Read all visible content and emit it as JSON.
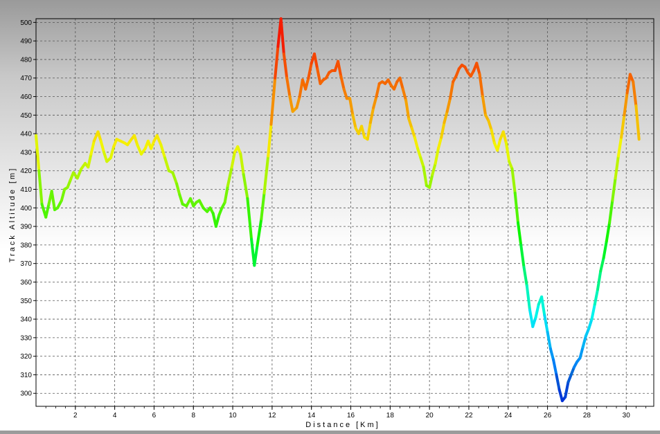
{
  "chart_data": {
    "type": "line",
    "title": "",
    "xlabel": "Distance [Km]",
    "ylabel": "Track Altitude [m]",
    "xlim": [
      0,
      31.4
    ],
    "ylim": [
      293,
      502
    ],
    "x_ticks": [
      "2",
      "4",
      "6",
      "8",
      "10",
      "12",
      "14",
      "16",
      "18",
      "20",
      "22",
      "24",
      "26",
      "28",
      "30"
    ],
    "y_ticks": [
      "300",
      "310",
      "320",
      "330",
      "340",
      "350",
      "360",
      "370",
      "380",
      "390",
      "400",
      "410",
      "420",
      "430",
      "440",
      "450",
      "460",
      "470",
      "480",
      "490",
      "500"
    ],
    "grid": true,
    "line_colormap": "altitude: blue (low) → cyan → green → yellow → orange → red (high)",
    "series": [
      {
        "points": [
          [
            0.0,
            439
          ],
          [
            0.15,
            420
          ],
          [
            0.3,
            402
          ],
          [
            0.5,
            395
          ],
          [
            0.65,
            402
          ],
          [
            0.8,
            409
          ],
          [
            0.95,
            399
          ],
          [
            1.1,
            400
          ],
          [
            1.3,
            404
          ],
          [
            1.45,
            410
          ],
          [
            1.6,
            411
          ],
          [
            1.75,
            415
          ],
          [
            1.9,
            419
          ],
          [
            2.1,
            416
          ],
          [
            2.3,
            421
          ],
          [
            2.5,
            424
          ],
          [
            2.65,
            422
          ],
          [
            2.8,
            429
          ],
          [
            2.95,
            436
          ],
          [
            3.15,
            441
          ],
          [
            3.3,
            436
          ],
          [
            3.45,
            430
          ],
          [
            3.6,
            425
          ],
          [
            3.8,
            427
          ],
          [
            3.95,
            433
          ],
          [
            4.1,
            437
          ],
          [
            4.3,
            436
          ],
          [
            4.5,
            435
          ],
          [
            4.65,
            434
          ],
          [
            4.85,
            437
          ],
          [
            5.0,
            439
          ],
          [
            5.15,
            434
          ],
          [
            5.35,
            429
          ],
          [
            5.55,
            432
          ],
          [
            5.7,
            436
          ],
          [
            5.85,
            432
          ],
          [
            6.0,
            436
          ],
          [
            6.15,
            439
          ],
          [
            6.35,
            434
          ],
          [
            6.55,
            427
          ],
          [
            6.75,
            420
          ],
          [
            6.95,
            419
          ],
          [
            7.15,
            413
          ],
          [
            7.3,
            407
          ],
          [
            7.45,
            402
          ],
          [
            7.65,
            401
          ],
          [
            7.85,
            405
          ],
          [
            8.0,
            401
          ],
          [
            8.15,
            403
          ],
          [
            8.3,
            404
          ],
          [
            8.5,
            400
          ],
          [
            8.7,
            398
          ],
          [
            8.85,
            400
          ],
          [
            9.0,
            397
          ],
          [
            9.15,
            390
          ],
          [
            9.3,
            396
          ],
          [
            9.45,
            400
          ],
          [
            9.6,
            403
          ],
          [
            9.75,
            412
          ],
          [
            9.95,
            422
          ],
          [
            10.1,
            430
          ],
          [
            10.25,
            433
          ],
          [
            10.4,
            429
          ],
          [
            10.55,
            418
          ],
          [
            10.75,
            405
          ],
          [
            10.95,
            383
          ],
          [
            11.1,
            369
          ],
          [
            11.25,
            380
          ],
          [
            11.45,
            394
          ],
          [
            11.6,
            408
          ],
          [
            11.8,
            428
          ],
          [
            11.95,
            445
          ],
          [
            12.15,
            470
          ],
          [
            12.3,
            487
          ],
          [
            12.45,
            502
          ],
          [
            12.6,
            483
          ],
          [
            12.75,
            470
          ],
          [
            12.9,
            460
          ],
          [
            13.05,
            452
          ],
          [
            13.25,
            454
          ],
          [
            13.4,
            460
          ],
          [
            13.55,
            469
          ],
          [
            13.7,
            464
          ],
          [
            13.85,
            470
          ],
          [
            14.0,
            478
          ],
          [
            14.15,
            483
          ],
          [
            14.3,
            475
          ],
          [
            14.45,
            467
          ],
          [
            14.6,
            469
          ],
          [
            14.75,
            470
          ],
          [
            14.9,
            473
          ],
          [
            15.05,
            474
          ],
          [
            15.2,
            474
          ],
          [
            15.35,
            479
          ],
          [
            15.5,
            471
          ],
          [
            15.65,
            464
          ],
          [
            15.8,
            459
          ],
          [
            15.95,
            459
          ],
          [
            16.1,
            450
          ],
          [
            16.25,
            443
          ],
          [
            16.4,
            440
          ],
          [
            16.55,
            444
          ],
          [
            16.7,
            438
          ],
          [
            16.85,
            437
          ],
          [
            17.0,
            446
          ],
          [
            17.15,
            454
          ],
          [
            17.3,
            460
          ],
          [
            17.45,
            467
          ],
          [
            17.6,
            468
          ],
          [
            17.75,
            467
          ],
          [
            17.9,
            469
          ],
          [
            18.05,
            466
          ],
          [
            18.2,
            464
          ],
          [
            18.35,
            468
          ],
          [
            18.5,
            470
          ],
          [
            18.65,
            464
          ],
          [
            18.8,
            458
          ],
          [
            18.95,
            448
          ],
          [
            19.1,
            443
          ],
          [
            19.25,
            438
          ],
          [
            19.4,
            432
          ],
          [
            19.55,
            427
          ],
          [
            19.7,
            422
          ],
          [
            19.85,
            412
          ],
          [
            20.0,
            411
          ],
          [
            20.15,
            418
          ],
          [
            20.3,
            424
          ],
          [
            20.45,
            432
          ],
          [
            20.6,
            438
          ],
          [
            20.75,
            446
          ],
          [
            20.9,
            452
          ],
          [
            21.05,
            459
          ],
          [
            21.2,
            468
          ],
          [
            21.35,
            471
          ],
          [
            21.5,
            475
          ],
          [
            21.65,
            477
          ],
          [
            21.8,
            476
          ],
          [
            21.95,
            473
          ],
          [
            22.1,
            471
          ],
          [
            22.25,
            474
          ],
          [
            22.4,
            478
          ],
          [
            22.55,
            472
          ],
          [
            22.7,
            460
          ],
          [
            22.85,
            450
          ],
          [
            23.0,
            447
          ],
          [
            23.15,
            442
          ],
          [
            23.3,
            435
          ],
          [
            23.45,
            431
          ],
          [
            23.6,
            437
          ],
          [
            23.75,
            441
          ],
          [
            23.9,
            435
          ],
          [
            24.05,
            425
          ],
          [
            24.2,
            421
          ],
          [
            24.35,
            408
          ],
          [
            24.5,
            392
          ],
          [
            24.65,
            380
          ],
          [
            24.8,
            368
          ],
          [
            24.95,
            358
          ],
          [
            25.1,
            345
          ],
          [
            25.25,
            336
          ],
          [
            25.4,
            341
          ],
          [
            25.55,
            348
          ],
          [
            25.7,
            352
          ],
          [
            25.85,
            342
          ],
          [
            26.0,
            333
          ],
          [
            26.15,
            324
          ],
          [
            26.3,
            318
          ],
          [
            26.45,
            310
          ],
          [
            26.6,
            302
          ],
          [
            26.75,
            296
          ],
          [
            26.9,
            298
          ],
          [
            27.05,
            306
          ],
          [
            27.2,
            310
          ],
          [
            27.35,
            314
          ],
          [
            27.5,
            317
          ],
          [
            27.65,
            319
          ],
          [
            27.8,
            325
          ],
          [
            27.95,
            331
          ],
          [
            28.1,
            335
          ],
          [
            28.25,
            340
          ],
          [
            28.4,
            348
          ],
          [
            28.55,
            356
          ],
          [
            28.7,
            366
          ],
          [
            28.85,
            373
          ],
          [
            29.0,
            382
          ],
          [
            29.15,
            392
          ],
          [
            29.3,
            404
          ],
          [
            29.45,
            416
          ],
          [
            29.6,
            428
          ],
          [
            29.75,
            438
          ],
          [
            29.9,
            450
          ],
          [
            30.05,
            462
          ],
          [
            30.2,
            472
          ],
          [
            30.35,
            468
          ],
          [
            30.5,
            455
          ],
          [
            30.65,
            437
          ]
        ]
      }
    ]
  }
}
